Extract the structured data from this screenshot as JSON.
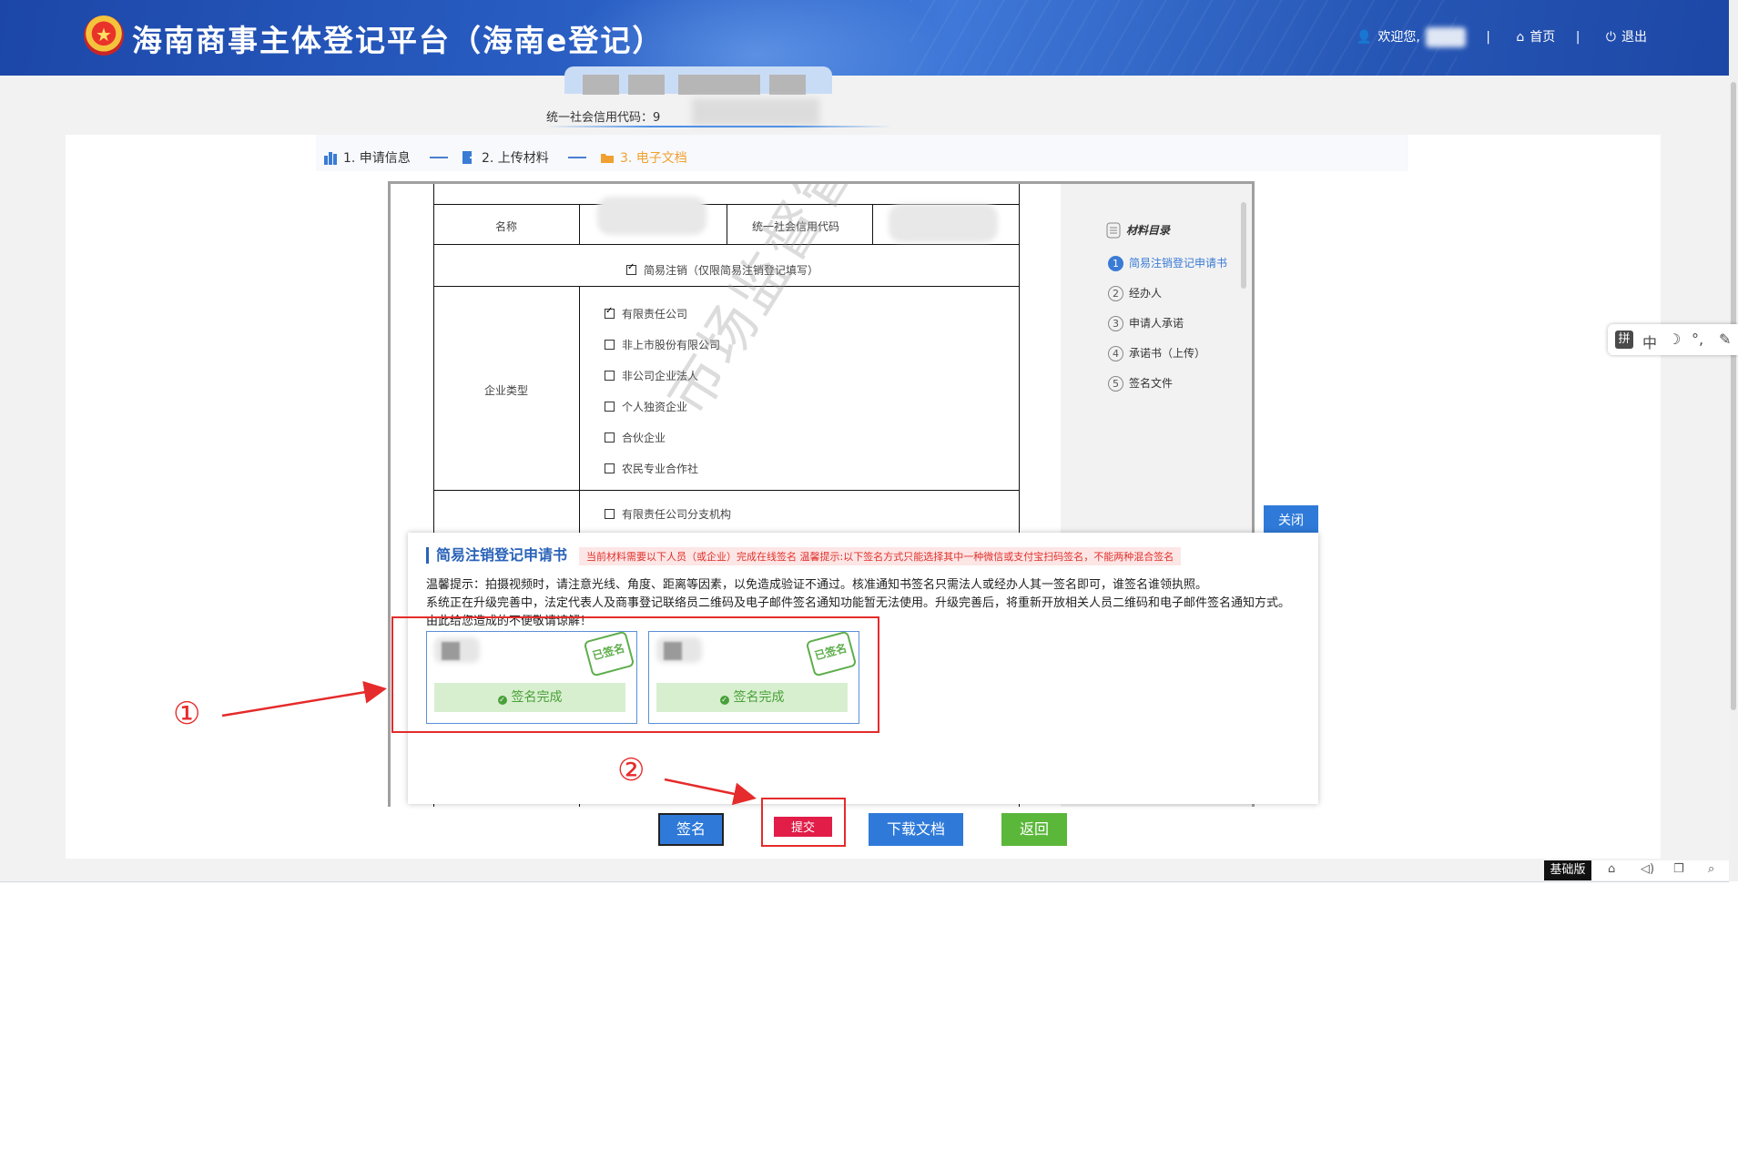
{
  "header": {
    "emblem_glyph": "★",
    "title": "海南商事主体登记平台（海南e登记）",
    "welcome": "欢迎您,",
    "home": "首页",
    "logout": "退出"
  },
  "company": {
    "credit_label": "统一社会信用代码：9"
  },
  "steps": [
    {
      "label": "1. 申请信息"
    },
    {
      "label": "2. 上传材料"
    },
    {
      "label": "3. 电子文档"
    }
  ],
  "document": {
    "name_label": "名称",
    "credit_label": "统一社会信用代码",
    "simple_cancel": "简易注销（仅限简易注销登记填写）",
    "enterprise_type_label": "企业类型",
    "types": [
      {
        "label": "有限责任公司",
        "checked": true
      },
      {
        "label": "非上市股份有限公司",
        "checked": false
      },
      {
        "label": "非公司企业法人",
        "checked": false
      },
      {
        "label": "个人独资企业",
        "checked": false
      },
      {
        "label": "合伙企业",
        "checked": false
      },
      {
        "label": "农民专业合作社",
        "checked": false
      }
    ],
    "branch_type": "有限责任公司分支机构",
    "watermark": "市场监督管理局"
  },
  "toc": {
    "title": "材料目录",
    "items": [
      {
        "num": "1",
        "label": "简易注销登记申请书"
      },
      {
        "num": "2",
        "label": "经办人"
      },
      {
        "num": "3",
        "label": "申请人承诺"
      },
      {
        "num": "4",
        "label": "承诺书（上传）"
      },
      {
        "num": "5",
        "label": "签名文件"
      }
    ]
  },
  "close_label": "关闭",
  "panel": {
    "title": "简易注销登记申请书",
    "warning": "当前材料需要以下人员（或企业）完成在线签名 温馨提示:以下签名方式只能选择其中一种微信或支付宝扫码签名，不能两种混合签名",
    "tip1": "温馨提示：拍摄视频时，请注意光线、角度、距离等因素，以免造成验证不通过。核准通知书签名只需法人或经办人其一签名即可，谁签名谁领执照。",
    "tip2": "系统正在升级完善中，法定代表人及商事登记联络员二维码及电子邮件签名通知功能暂无法使用。升级完善后，将重新开放相关人员二维码和电子邮件签名通知方式。由此给您造成的不便敬请谅解！",
    "signers": [
      {
        "stamp": "已签名",
        "status": "签名完成"
      },
      {
        "stamp": "已签名",
        "status": "签名完成"
      }
    ]
  },
  "annotations": {
    "one": "①",
    "two": "②"
  },
  "buttons": {
    "sign": "签名",
    "submit": "提交",
    "download": "下载文档",
    "back": "返回"
  },
  "ime": {
    "pin": "拼",
    "lang": "中",
    "moon": "☽",
    "punct": "°,",
    "pen": "✎"
  },
  "bottom": {
    "base": "基础版",
    "home_icon": "⌂",
    "speaker_icon": "◁)",
    "window_icon": "❐",
    "search_icon": "⌕"
  }
}
